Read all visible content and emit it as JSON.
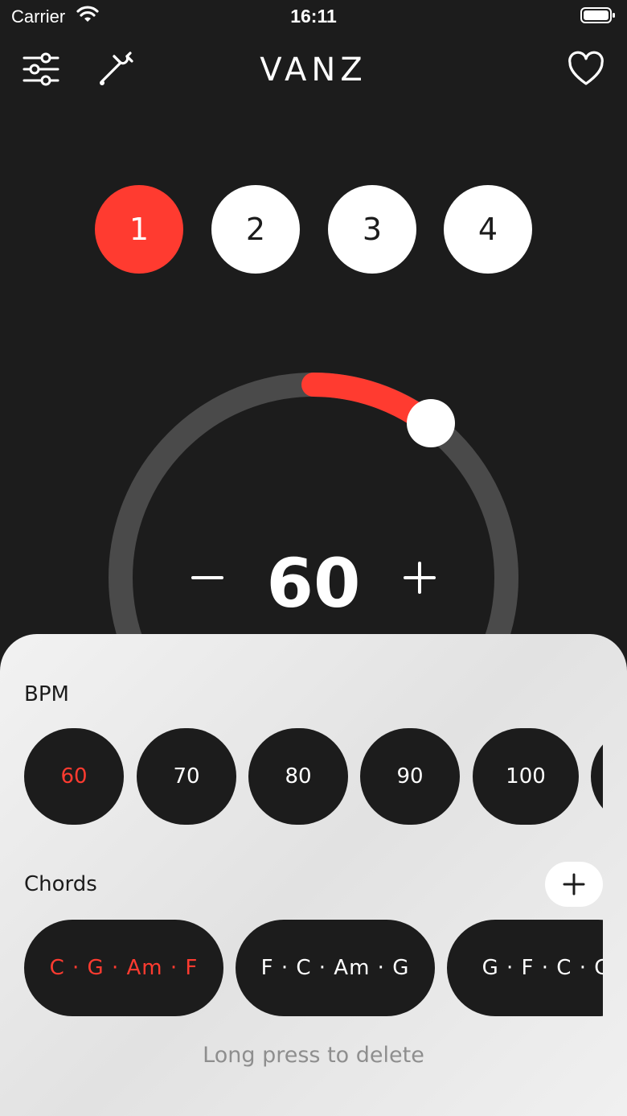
{
  "status_bar": {
    "carrier": "Carrier",
    "time": "16:11",
    "icons": [
      "wifi-icon",
      "battery-icon"
    ]
  },
  "nav": {
    "title": "VANZ",
    "icons": [
      "sliders-icon",
      "tuning-fork-icon",
      "heart-icon"
    ]
  },
  "beats": [
    {
      "label": "1",
      "active": true
    },
    {
      "label": "2",
      "active": false
    },
    {
      "label": "3",
      "active": false
    },
    {
      "label": "4",
      "active": false
    }
  ],
  "tempo": {
    "value": "60",
    "icons": [
      "minus-icon",
      "plus-icon"
    ]
  },
  "sheet": {
    "bpm_label": "BPM",
    "bpm_options": [
      "60",
      "70",
      "80",
      "90",
      "100"
    ],
    "bpm_selected": "60",
    "chords_label": "Chords",
    "chord_options": [
      "C · G · Am · F",
      "F · C · Am · G",
      "G · F · C · G"
    ],
    "chord_selected": "C · G · Am · F",
    "hint": "Long press to delete"
  },
  "colors": {
    "background": "#1c1c1c",
    "accent": "#ff3b30",
    "sheet": "#eeeeee",
    "chip": "#1c1c1c",
    "hint": "#8e8e8e",
    "dial_track": "#4a4a4a"
  }
}
